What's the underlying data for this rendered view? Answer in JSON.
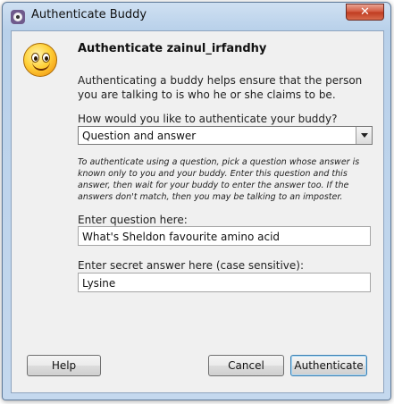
{
  "window": {
    "title": "Authenticate Buddy",
    "close_label": "✕"
  },
  "dialog": {
    "heading": "Authenticate zainul_irfandhy",
    "description": "Authenticating a buddy helps ensure that the person you are talking to is who he or she claims to be.",
    "method_prompt": "How would you like to authenticate your buddy?",
    "method_selected": "Question and answer",
    "hint": "To authenticate using a question, pick a question whose answer is known only to you and your buddy.  Enter this question and this answer, then wait for your buddy to enter the answer too.  If the answers don't match, then you may be talking to an imposter.",
    "question_label": "Enter question here:",
    "question_value": "What's Sheldon favourite amino acid",
    "answer_label": "Enter secret answer here (case sensitive):",
    "answer_value": "Lysine"
  },
  "buttons": {
    "help": "Help",
    "cancel": "Cancel",
    "authenticate": "Authenticate"
  }
}
